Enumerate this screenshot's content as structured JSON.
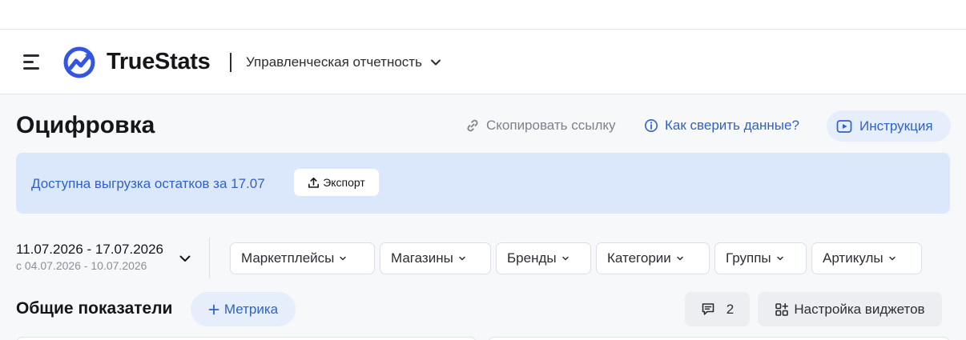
{
  "app": {
    "name": "TrueStats",
    "report_selector": "Управленческая отчетность"
  },
  "page": {
    "title": "Оцифровка",
    "copy_link_label": "Скопировать ссылку",
    "check_data_label": "Как сверить данные?",
    "instruction_label": "Инструкция"
  },
  "banner": {
    "text": "Доступна выгрузка остатков за 17.07",
    "export_label": "Экспорт"
  },
  "period": {
    "range": "11.07.2026 - 17.07.2026",
    "compare": "с 04.07.2026 - 10.07.2026"
  },
  "filters": [
    {
      "label": "Маркетплейсы"
    },
    {
      "label": "Магазины"
    },
    {
      "label": "Бренды"
    },
    {
      "label": "Категории"
    },
    {
      "label": "Группы"
    },
    {
      "label": "Артикулы"
    }
  ],
  "section": {
    "title": "Общие показатели",
    "add_metric_label": "Метрика",
    "comments_count": "2",
    "widgets_settings_label": "Настройка виджетов"
  },
  "colors": {
    "accent": "#2f62c9",
    "logo": "#3355e0",
    "banner_bg": "#dbe8fb",
    "pill_bg": "#e6eefb"
  }
}
